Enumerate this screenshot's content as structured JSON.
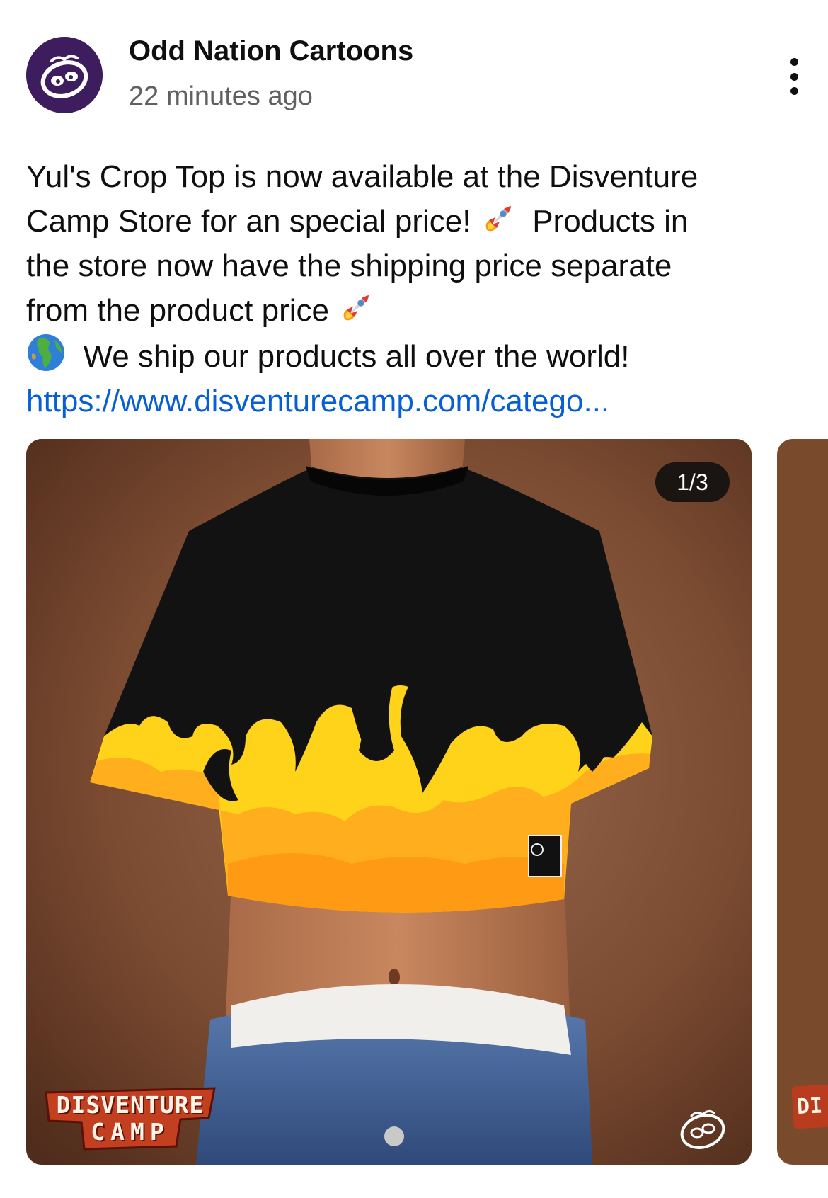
{
  "post": {
    "channel_name": "Odd Nation Cartoons",
    "timestamp": "22 minutes ago",
    "text_lines": {
      "line1": "Yul's Crop Top is now available at the Disventure",
      "line2_a": "Camp Store for an special price!",
      "line2_b": "Products in",
      "line3": "the store now have the shipping price separate",
      "line4": "from the product price",
      "line5": "We ship our products all over the world!"
    },
    "link": "https://www.disventurecamp.com/catego...",
    "emojis": [
      "rocket-emoji",
      "rocket-emoji",
      "globe-emoji"
    ]
  },
  "carousel": {
    "counter": "1/3",
    "slide_logo_line1": "DISVENTURE",
    "slide_logo_line2": "CAMP",
    "next_slide_logo": "DI"
  },
  "icons": {
    "avatar": "sloth-logo-avatar",
    "more": "more-vertical-icon",
    "watermark": "sloth-logo-watermark"
  },
  "colors": {
    "link": "#065fd4",
    "avatar_bg": "#3d1d5e",
    "secondary_text": "#606060",
    "counter_bg": "#0f0f0f"
  }
}
